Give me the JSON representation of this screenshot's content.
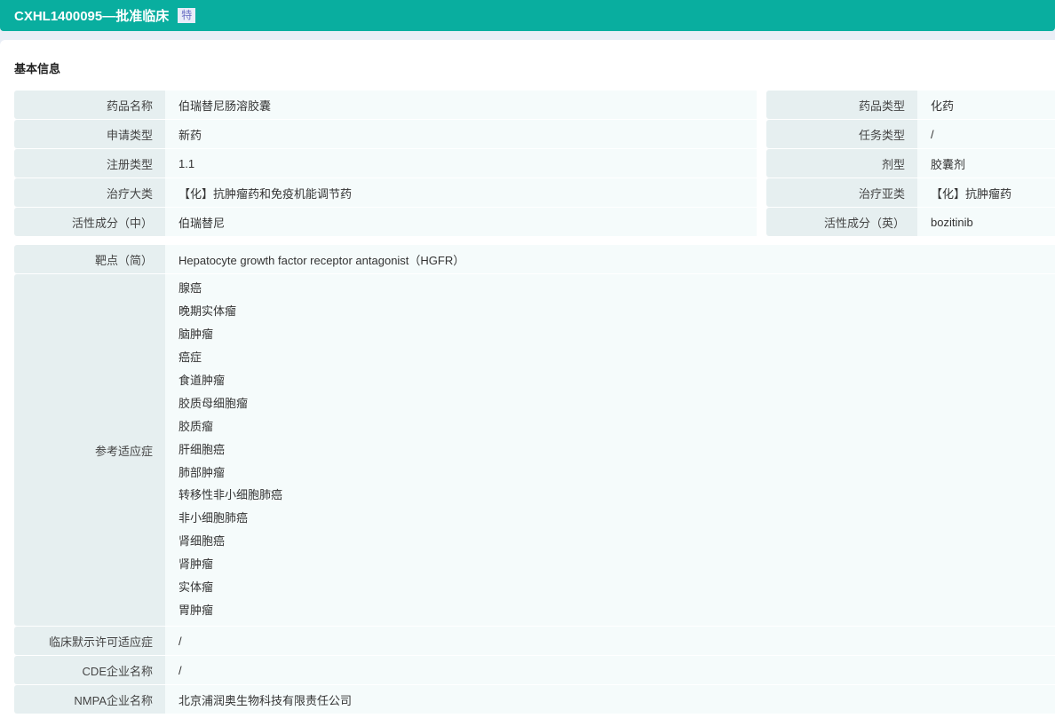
{
  "header": {
    "title": "CXHL1400095—批准临床",
    "badge": "特"
  },
  "section_title": "基本信息",
  "left_rows": [
    {
      "label": "药品名称",
      "value": "伯瑞替尼肠溶胶囊"
    },
    {
      "label": "申请类型",
      "value": "新药"
    },
    {
      "label": "注册类型",
      "value": "1.1"
    },
    {
      "label": "治疗大类",
      "value": "【化】抗肿瘤药和免疫机能调节药"
    },
    {
      "label": "活性成分（中）",
      "value": "伯瑞替尼"
    }
  ],
  "right_rows": [
    {
      "label": "药品类型",
      "value": "化药"
    },
    {
      "label": "任务类型",
      "value": "/"
    },
    {
      "label": "剂型",
      "value": "胶囊剂"
    },
    {
      "label": "治疗亚类",
      "value": "【化】抗肿瘤药"
    },
    {
      "label": "活性成分（英）",
      "value": "bozitinib"
    }
  ],
  "target": {
    "label": "靶点（简）",
    "value": "Hepatocyte growth factor receptor antagonist（HGFR）"
  },
  "indications": {
    "label": "参考适应症",
    "items": [
      "腺癌",
      "晚期实体瘤",
      "脑肿瘤",
      "癌症",
      "食道肿瘤",
      "胶质母细胞瘤",
      "胶质瘤",
      "肝细胞癌",
      "肺部肿瘤",
      "转移性非小细胞肺癌",
      "非小细胞肺癌",
      "肾细胞癌",
      "肾肿瘤",
      "实体瘤",
      "胃肿瘤"
    ]
  },
  "bottom_rows": [
    {
      "label": "临床默示许可适应症",
      "value": "/"
    },
    {
      "label": "CDE企业名称",
      "value": "/"
    },
    {
      "label": "NMPA企业名称",
      "value": "北京浦润奥生物科技有限责任公司"
    }
  ]
}
